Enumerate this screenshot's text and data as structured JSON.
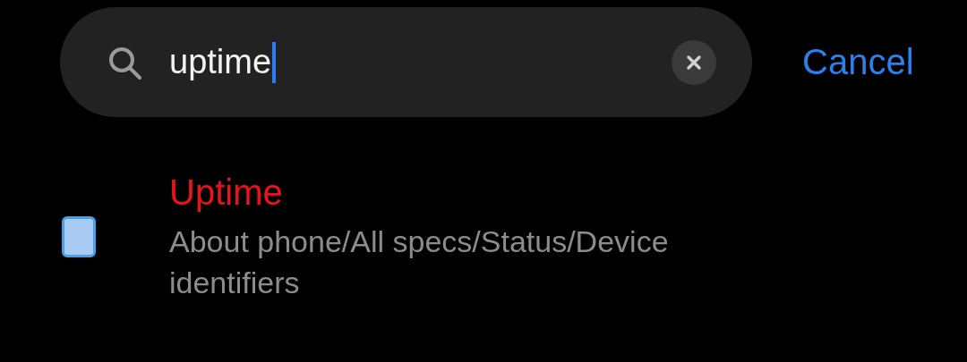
{
  "search": {
    "value": "uptime",
    "cancel": "Cancel"
  },
  "results": [
    {
      "title": "Uptime",
      "path": "About phone/All specs/Status/Device identifiers"
    }
  ]
}
